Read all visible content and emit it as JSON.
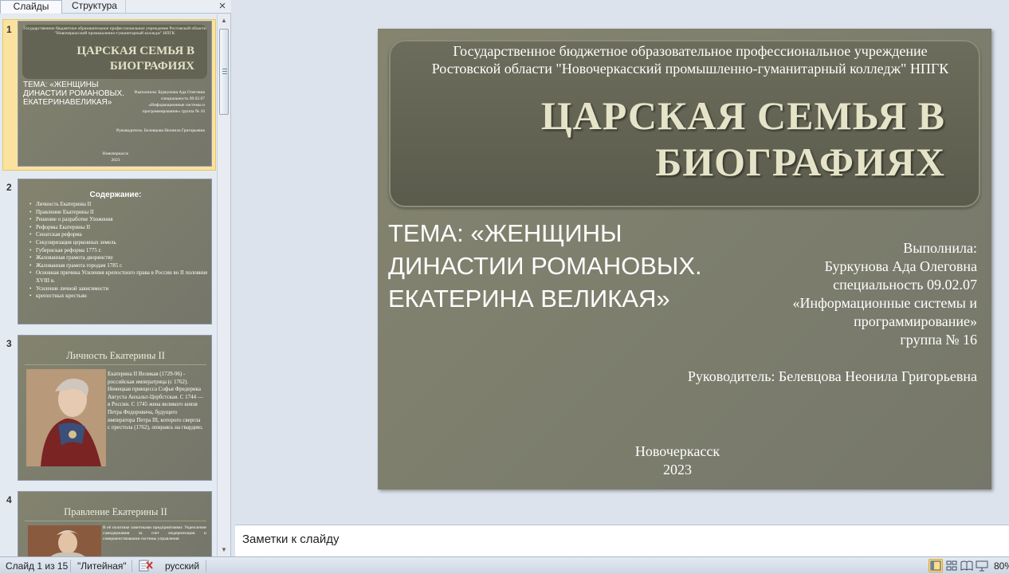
{
  "left_panel": {
    "tabs": [
      "Слайды",
      "Структура"
    ],
    "close_glyph": "×"
  },
  "thumbnails": {
    "numbers": [
      "1",
      "2",
      "3",
      "4"
    ],
    "slide1": {
      "header": "Государственное бюджетное образовательное профессиональное учреждение Ростовской области \"Новочеркасский промышленно-гуманитарный колледж\" НПГК",
      "title": "ЦАРСКАЯ СЕМЬЯ В БИОГРАФИЯХ",
      "theme": "ТЕМА: «ЖЕНЩИНЫ ДИНАСТИИ РОМАНОВЫХ. ЕКАТЕРИНАВЕЛИКАЯ»",
      "author": "Выполнила: Буркунова Ада Олеговна специальность 09.02.07 «Информационные системы и программирование» группа № 16",
      "supervisor": "Руководитель: Белевцова Неонила Григорьевна",
      "city": "Новочеркасск",
      "year": "2023"
    },
    "slide2": {
      "heading": "Содержание:",
      "items": [
        "Личность Екатерины II",
        "Правление Екатерины II",
        "Решение о разработке Уложения",
        "Реформы Екатерины II",
        "Сенатская реформа",
        "Секуляризация церковных земель",
        "Губернская реформа 1775 г.",
        "Жалованная грамота дворянству",
        "Жалованная грамота городам 1785 г.",
        "Основная причина Усиления крепостного права в России во II половине XVIII в.",
        "Усиление личной зависимости",
        "крепостных крестьян"
      ]
    },
    "slide3": {
      "title": "Личность Екатерины II",
      "text": "Екатерина II Великая (1729-96) - российская императрица (с 1762). Немецкая принцесса Софья Фредерика Августа Анхальт-Цербстская. С 1744 — в России. С 1745 жена великого князя Петра Федоровича, будущего императора Петра III, которого свергла с престола (1762), опираясь на гвардию."
    },
    "slide4": {
      "title": "Правление Екатерины II",
      "text": "В её политике заметными предприятиями: Укрепление самодержавия за счет модернизации и совершенствования системы управления"
    }
  },
  "slide": {
    "institution_line1": "Государственное бюджетное образовательное профессиональное учреждение",
    "institution_line2": "Ростовской области \"Новочеркасский промышленно-гуманитарный колледж\" НПГК",
    "title_line1": "ЦАРСКАЯ СЕМЬЯ В",
    "title_line2": "БИОГРАФИЯХ",
    "theme_line1": "ТЕМА: «ЖЕНЩИНЫ",
    "theme_line2": "ДИНАСТИИ РОМАНОВЫХ.",
    "theme_line3": "ЕКАТЕРИНА ВЕЛИКАЯ»",
    "author_lines": [
      "Выполнила:",
      "Буркунова Ада Олеговна",
      "специальность 09.02.07",
      "«Информационные системы и",
      "программирование»",
      "группа № 16"
    ],
    "supervisor": "Руководитель: Белевцова Неонила Григорьевна",
    "city": "Новочеркасск",
    "year": "2023"
  },
  "notes": {
    "placeholder": "Заметки к слайду"
  },
  "status_bar": {
    "slide_counter": "Слайд 1 из 15",
    "theme_name": "\"Литейная\"",
    "language": "русский",
    "zoom": "80%"
  }
}
